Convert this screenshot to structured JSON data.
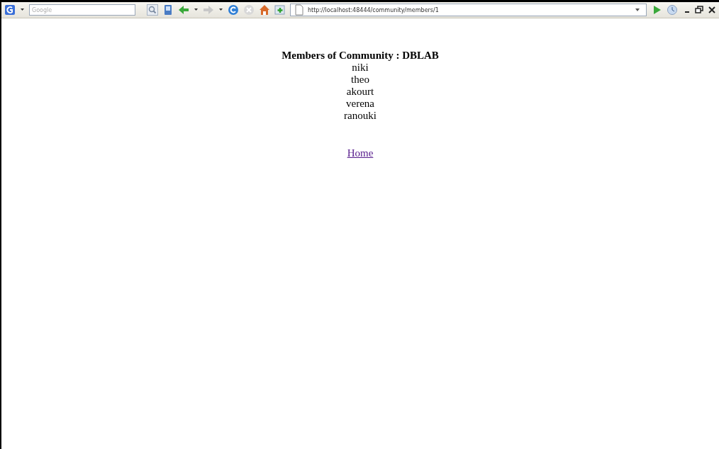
{
  "toolbar": {
    "search": {
      "placeholder": "Google"
    },
    "address": {
      "value": "http://localhost:48444/community/members/1"
    }
  },
  "page": {
    "heading": "Members of Community : DBLAB",
    "members": [
      "niki",
      "theo",
      "akourt",
      "verena",
      "ranouki"
    ],
    "home_link": "Home"
  }
}
